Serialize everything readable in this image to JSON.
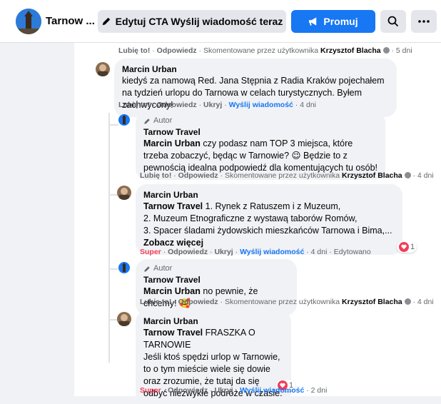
{
  "header": {
    "page_name": "Tarnow ...",
    "cta_label": "Edytuj CTA Wyślij wiadomość teraz",
    "promote_label": "Promuj"
  },
  "labels": {
    "like": "Lubię to!",
    "super": "Super",
    "reply": "Odpowiedz",
    "hide": "Ukryj",
    "send_message": "Wyślij wiadomość",
    "commented_by": "Skomentowane przez użytkownika",
    "author_badge": "Autor",
    "edited": "Edytowano",
    "sep": "·"
  },
  "comments": [
    {
      "actions": {
        "reaction": "Lubię to!",
        "by": "Krzysztof Blacha",
        "time": "5 dni"
      }
    },
    {
      "name": "Marcin Urban",
      "text": "kiedyś za namową Red. Jana Stępnia z Radia Kraków pojechałem na tydzień urlopu do Tarnowa w celach turystycznych. Byłem zachwycony!",
      "actions": {
        "time": "4 dni"
      }
    },
    {
      "name": "Tarnow Travel",
      "mention": "Marcin Urban",
      "text": " czy podasz nam TOP 3 miejsca, które trzeba zobaczyć, będąc w Tarnowie? 😉 Będzie to z pewnością idealna podpowiedź dla komentujących tu osób!",
      "actions": {
        "by": "Krzysztof Blacha",
        "time": "4 dni"
      }
    },
    {
      "name": "Marcin Urban",
      "mention": "Tarnow Travel",
      "lines": [
        " 1. Rynek z Ratuszem i z Muzeum,",
        "2. Muzeum Etnograficzne z wystawą taborów Romów,",
        "3. Spacer śladami żydowskich mieszkańców Tarnowa i Bima,... "
      ],
      "see_more": "Zobacz więcej",
      "reaction_count": "1",
      "actions": {
        "time": "4 dni"
      }
    },
    {
      "name": "Tarnow Travel",
      "mention": "Marcin Urban",
      "text": " no pewnie, że chcemy! 🥰",
      "actions": {
        "by": "Krzysztof Blacha",
        "time": "4 dni"
      }
    },
    {
      "name": "Marcin Urban",
      "mention": "Tarnow Travel",
      "first_line": " FRASZKA O TARNOWIE",
      "lines": [
        "Jeśli ktoś spędzi urlop w Tarnowie,",
        "to o tym mieście wiele się dowie",
        "oraz zrozumie, że tutaj da się",
        "odbyć niezwykłe podróże w czasie."
      ],
      "reaction_count": "1",
      "actions": {
        "time": "2 dni"
      }
    }
  ]
}
